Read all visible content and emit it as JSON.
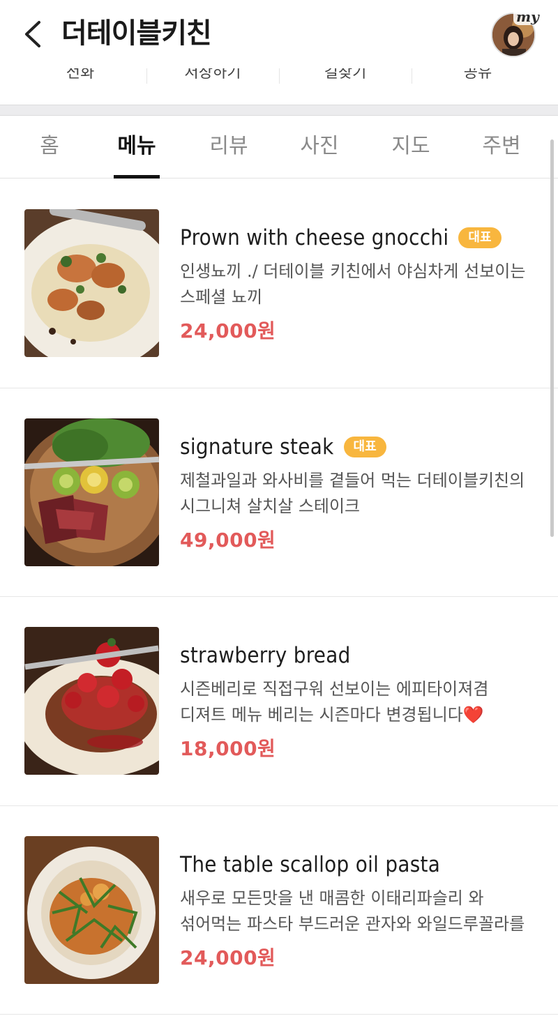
{
  "header": {
    "title": "더테이블키친",
    "avatar_badge": "my",
    "back_icon": "chevron-left-icon"
  },
  "actions": [
    {
      "label": "전화"
    },
    {
      "label": "저장하기"
    },
    {
      "label": "길찾기"
    },
    {
      "label": "공유"
    }
  ],
  "tabs": [
    {
      "label": "홈",
      "active": false
    },
    {
      "label": "메뉴",
      "active": true
    },
    {
      "label": "리뷰",
      "active": false
    },
    {
      "label": "사진",
      "active": false
    },
    {
      "label": "지도",
      "active": false
    },
    {
      "label": "주변",
      "active": false
    }
  ],
  "menu": [
    {
      "name": "Prown with cheese gnocchi",
      "badge": "대표",
      "description": "인생뇨끼 ./ 더테이블 키친에서 야심차게 선보이는 스페셜 뇨끼",
      "price": "24,000원"
    },
    {
      "name": "signature steak",
      "badge": "대표",
      "description": "제철과일과 와사비를 곁들어 먹는 더테이블키친의 시그니쳐 살치살 스테이크",
      "price": "49,000원"
    },
    {
      "name": "strawberry bread",
      "badge": "",
      "description": "시즌베리로 직접구워 선보이는 에피타이져겸 디져트 메뉴 베리는 시즌마다 변경됩니다❤️",
      "price": "18,000원"
    },
    {
      "name": "The table scallop oil pasta",
      "badge": "",
      "description": "새우로 모든맛을 낸 매콤한 이태리파슬리 와 섞어먹는 파스타 부드러운 관자와 와일드루꼴라를 곁들여 먹는…",
      "price": "24,000원"
    }
  ],
  "colors": {
    "price": "#e25a5a",
    "badge": "#f8b63e",
    "active_tab": "#111111"
  }
}
